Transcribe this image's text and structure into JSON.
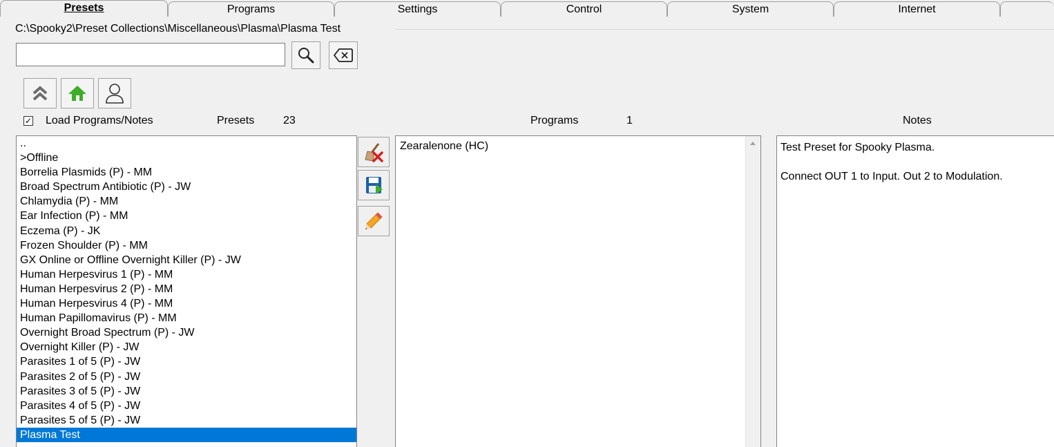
{
  "tabs": [
    {
      "label": "Presets",
      "active": true
    },
    {
      "label": "Programs",
      "active": false
    },
    {
      "label": "Settings",
      "active": false
    },
    {
      "label": "Control",
      "active": false
    },
    {
      "label": "System",
      "active": false
    },
    {
      "label": "Internet",
      "active": false
    },
    {
      "label": "",
      "active": false
    }
  ],
  "path": "C:\\Spooky2\\Preset Collections\\Miscellaneous\\Plasma\\Plasma Test",
  "search": {
    "value": "",
    "placeholder": ""
  },
  "icons": {
    "search": "magnifier-icon",
    "clear": "backspace-clear-icon",
    "up": "double-chevron-up-icon",
    "home": "home-icon",
    "user": "user-icon",
    "delete": "broom-delete-icon",
    "save": "save-disk-icon",
    "edit": "pencil-icon"
  },
  "options": {
    "load_programs_notes_label": "Load Programs/Notes",
    "load_programs_notes_checked": true
  },
  "presets": {
    "label": "Presets",
    "count": "23",
    "items": [
      "..",
      ">Offline",
      "Borrelia Plasmids (P) - MM",
      "Broad Spectrum Antibiotic (P) - JW",
      "Chlamydia (P) - MM",
      "Ear Infection (P) - MM",
      "Eczema (P) - JK",
      "Frozen Shoulder (P) - MM",
      "GX Online or Offline Overnight Killer (P) - JW",
      "Human Herpesvirus 1 (P) - MM",
      "Human Herpesvirus 2 (P) - MM",
      "Human Herpesvirus 4 (P) - MM",
      "Human Papillomavirus (P) - MM",
      "Overnight Broad Spectrum (P) - JW",
      "Overnight Killer (P) - JW",
      "Parasites 1 of 5 (P) - JW",
      "Parasites 2 of 5 (P) - JW",
      "Parasites 3 of 5 (P) - JW",
      "Parasites 4 of 5 (P) - JW",
      "Parasites 5 of 5 (P) - JW",
      "Plasma Test"
    ],
    "selected": "Plasma Test"
  },
  "programs": {
    "label": "Programs",
    "count": "1",
    "items": [
      "Zearalenone (HC)"
    ]
  },
  "notes": {
    "label": "Notes",
    "lines": [
      "Test Preset for Spooky Plasma.",
      "",
      "Connect OUT 1 to Input. Out 2 to Modulation."
    ]
  },
  "colors": {
    "selection": "#0078d7",
    "home_green": "#3fae29",
    "chevron_grey": "#6d6d6d"
  }
}
